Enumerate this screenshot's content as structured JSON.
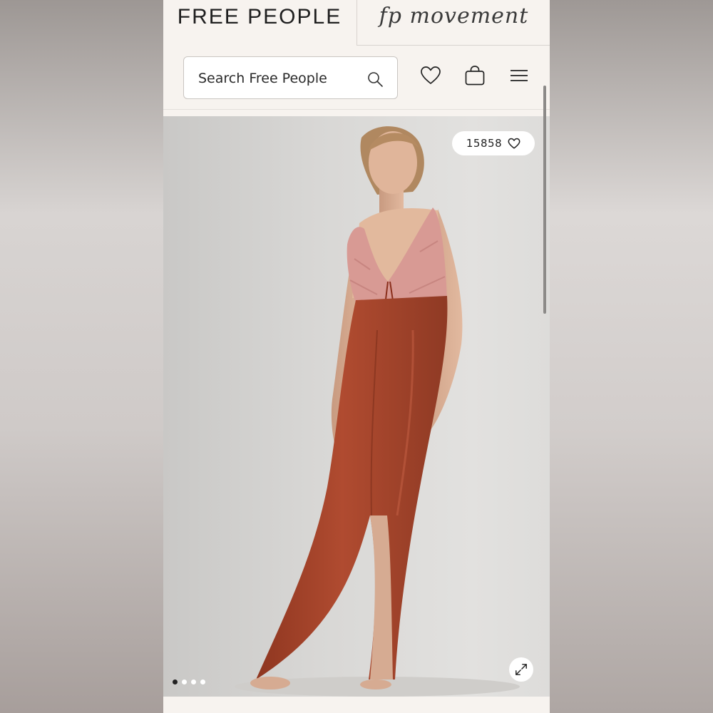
{
  "header": {
    "brand_primary": "FREE PEOPLE",
    "brand_secondary": "fp movement"
  },
  "search": {
    "placeholder": "Search Free People"
  },
  "icons": {
    "search": "search-icon",
    "wishlist": "heart-icon",
    "bag": "shopping-bag-icon",
    "menu": "hamburger-menu-icon",
    "expand": "expand-icon"
  },
  "product": {
    "like_count": "15858",
    "image_alt": "Model in rust satin maxi slip dress with pink lace bodice",
    "carousel": {
      "total": 4,
      "active": 1
    }
  },
  "colors": {
    "background": "#f7f3ef",
    "dress": "#a8452c",
    "lace": "#d89a94"
  }
}
